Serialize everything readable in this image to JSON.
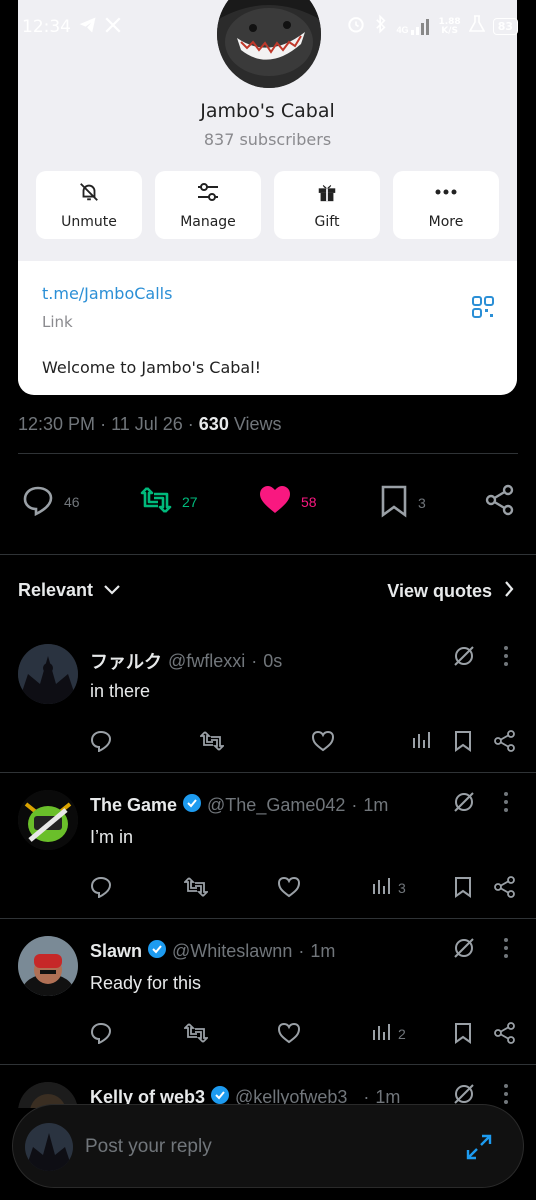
{
  "status_bar": {
    "time": "12:34",
    "network": "4G",
    "speed_value": "1.88",
    "speed_unit": "K/S",
    "battery": "83"
  },
  "card": {
    "channel_name": "Jambo's Cabal",
    "subscribers": "837 subscribers",
    "actions": [
      "Unmute",
      "Manage",
      "Gift",
      "More"
    ],
    "link": "t.me/JamboCalls",
    "link_label": "Link",
    "description": "Welcome to Jambo's Cabal!"
  },
  "post_meta": {
    "time": "12:30 PM",
    "date": "11 Jul 26",
    "views_count": "630",
    "views_label": "Views"
  },
  "post_actions": {
    "replies": "46",
    "reposts": "27",
    "likes": "58",
    "bookmarks": "3"
  },
  "filter": {
    "sort_label": "Relevant",
    "quotes_label": "View quotes"
  },
  "replies": [
    {
      "name": "ファルク",
      "handle": "@fwflexxi",
      "time": "0s",
      "text": "in there",
      "views": ""
    },
    {
      "name": "The Game",
      "handle": "@The_Game042",
      "time": "1m",
      "text": "I’m in",
      "views": "3"
    },
    {
      "name": "Slawn",
      "handle": "@Whiteslawnn",
      "time": "1m",
      "text": "Ready for this",
      "views": "2"
    },
    {
      "name": "Kelly of web3",
      "handle": "@kellyofweb3_",
      "time": "1m",
      "text": "",
      "views": ""
    }
  ],
  "reply_bar": {
    "placeholder": "Post your reply"
  },
  "colors": {
    "background": "#000000",
    "text": "#e7e9ea",
    "muted": "#71767b",
    "repost_green": "#00ba7c",
    "like_pink": "#f91880",
    "verified_blue": "#1d9bf0",
    "link_blue": "#2b8fd6"
  }
}
